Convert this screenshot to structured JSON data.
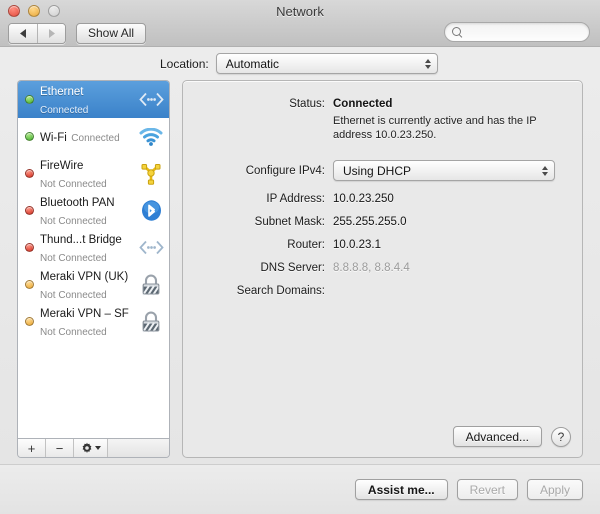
{
  "window": {
    "title": "Network",
    "traffic": {
      "close": "close-button",
      "minimize": "minimize-button",
      "zoom": "zoom-button"
    }
  },
  "toolbar": {
    "back_label": "◀",
    "forward_label": "▶",
    "show_all_label": "Show All",
    "search_placeholder": "",
    "search_value": ""
  },
  "location": {
    "label": "Location:",
    "value": "Automatic"
  },
  "sidebar": {
    "services": [
      {
        "name": "Ethernet",
        "status": "Connected",
        "dot": "green",
        "icon": "ethernet-icon",
        "selected": true
      },
      {
        "name": "Wi-Fi",
        "status": "Connected",
        "dot": "green",
        "icon": "wifi-icon",
        "selected": false
      },
      {
        "name": "FireWire",
        "status": "Not Connected",
        "dot": "red",
        "icon": "firewire-icon",
        "selected": false
      },
      {
        "name": "Bluetooth PAN",
        "status": "Not Connected",
        "dot": "red",
        "icon": "bluetooth-icon",
        "selected": false
      },
      {
        "name": "Thund...t Bridge",
        "status": "Not Connected",
        "dot": "red",
        "icon": "ethernet-icon",
        "selected": false
      },
      {
        "name": "Meraki VPN (UK)",
        "status": "Not Connected",
        "dot": "amber",
        "icon": "lock-icon",
        "selected": false
      },
      {
        "name": "Meraki VPN – SF",
        "status": "Not Connected",
        "dot": "amber",
        "icon": "lock-icon",
        "selected": false
      }
    ],
    "footer": {
      "add_label": "+",
      "remove_label": "−",
      "action_label": "gear-icon"
    }
  },
  "detail": {
    "status_label": "Status:",
    "status_value": "Connected",
    "status_description": "Ethernet is currently active and has the IP address 10.0.23.250.",
    "configure_label": "Configure IPv4:",
    "configure_value": "Using DHCP",
    "fields": [
      {
        "label": "IP Address:",
        "value": "10.0.23.250",
        "muted": false
      },
      {
        "label": "Subnet Mask:",
        "value": "255.255.255.0",
        "muted": false
      },
      {
        "label": "Router:",
        "value": "10.0.23.1",
        "muted": false
      },
      {
        "label": "DNS Server:",
        "value": "8.8.8.8, 8.8.4.4",
        "muted": true
      },
      {
        "label": "Search Domains:",
        "value": "",
        "muted": false
      }
    ],
    "advanced_label": "Advanced...",
    "help_label": "?"
  },
  "footer": {
    "assist_label": "Assist me...",
    "revert_label": "Revert",
    "apply_label": "Apply"
  },
  "colors": {
    "selection_blue": "#4a90d9",
    "status_green": "#3faa2b",
    "status_red": "#cc2a1c",
    "status_amber": "#e8a22c"
  }
}
